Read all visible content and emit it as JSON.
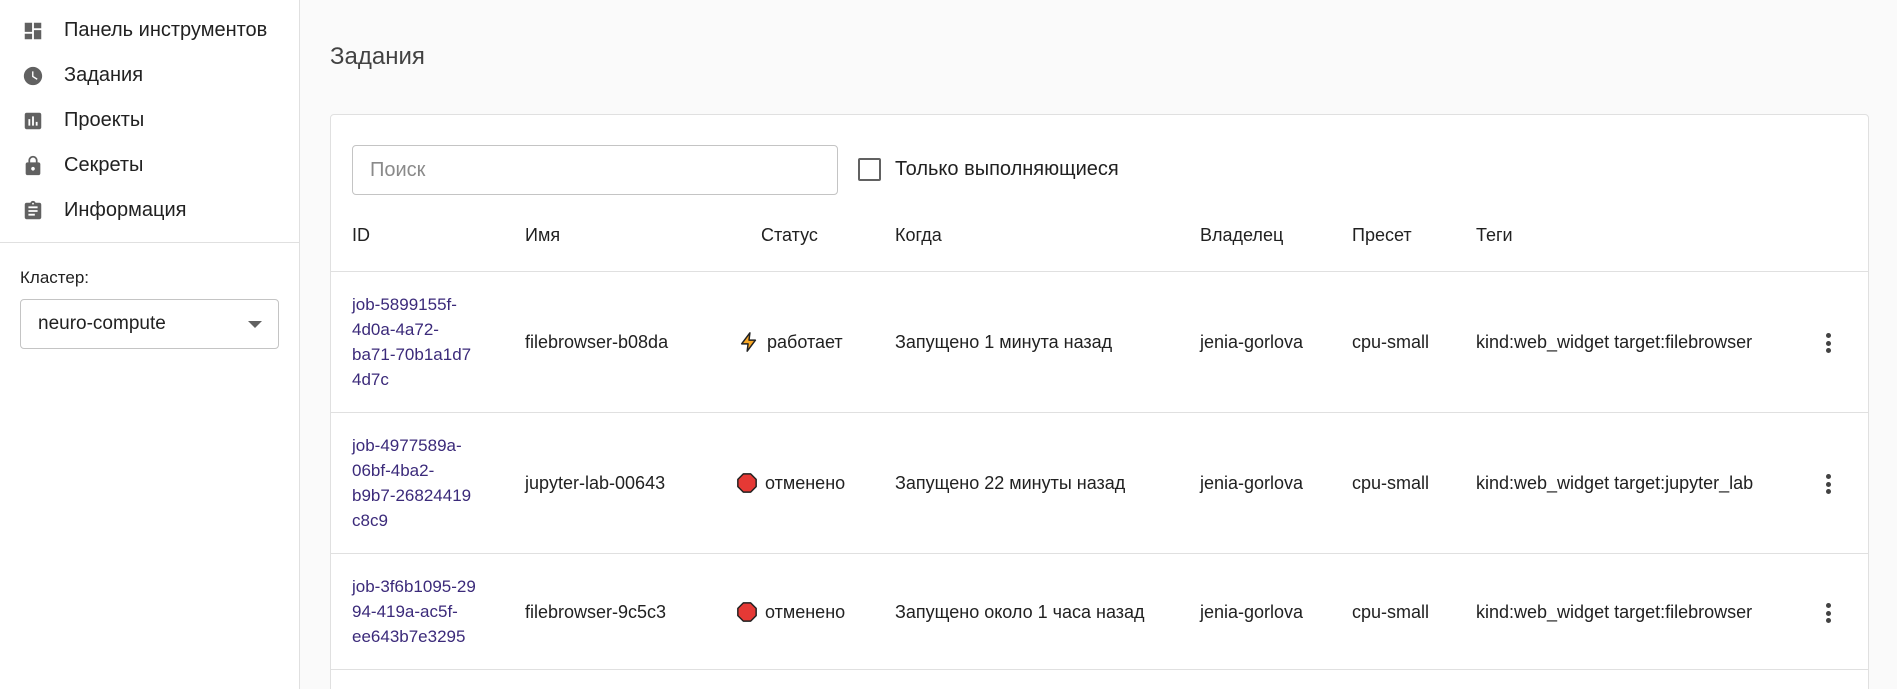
{
  "sidebar": {
    "nav": [
      {
        "label": "Панель инструментов",
        "icon": "dashboard-icon"
      },
      {
        "label": "Задания",
        "icon": "clock-icon"
      },
      {
        "label": "Проекты",
        "icon": "bar-chart-icon"
      },
      {
        "label": "Секреты",
        "icon": "lock-icon"
      },
      {
        "label": "Информация",
        "icon": "clipboard-icon"
      }
    ],
    "cluster_label": "Кластер:",
    "cluster_value": "neuro-compute"
  },
  "page": {
    "title": "Задания"
  },
  "search": {
    "placeholder": "Поиск",
    "value": ""
  },
  "filter": {
    "only_running_label": "Только выполняющиеся",
    "checked": false
  },
  "table": {
    "headers": {
      "id": "ID",
      "name": "Имя",
      "status": "Статус",
      "when": "Когда",
      "owner": "Владелец",
      "preset": "Пресет",
      "tags": "Теги"
    },
    "rows": [
      {
        "id_lines": [
          "job-5899155f-",
          "4d0a-4a72-",
          "ba71-70b1a1d7",
          "4d7c"
        ],
        "name": "filebrowser-b08da",
        "status": "работает",
        "status_icon": "lightning-icon",
        "when": "Запущено 1 минута назад",
        "owner": "jenia-gorlova",
        "preset": "cpu-small",
        "tags": "kind:web_widget target:filebrowser"
      },
      {
        "id_lines": [
          "job-4977589a-",
          "06bf-4ba2-",
          "b9b7-26824419",
          "c8c9"
        ],
        "name": "jupyter-lab-00643",
        "status": "отменено",
        "status_icon": "stop-icon",
        "when": "Запущено 22 минуты назад",
        "owner": "jenia-gorlova",
        "preset": "cpu-small",
        "tags": "kind:web_widget target:jupyter_lab"
      },
      {
        "id_lines": [
          "job-3f6b1095-29",
          "94-419a-ac5f-",
          "ee643b7e3295"
        ],
        "name": "filebrowser-9c5c3",
        "status": "отменено",
        "status_icon": "stop-icon",
        "when": "Запущено около 1 часа назад",
        "owner": "jenia-gorlova",
        "preset": "cpu-small",
        "tags": "kind:web_widget target:filebrowser"
      }
    ]
  },
  "colors": {
    "link": "#3b2a7a",
    "stop_red": "#e53935",
    "lightning": "#f9a825",
    "icon_gray": "#616161"
  }
}
